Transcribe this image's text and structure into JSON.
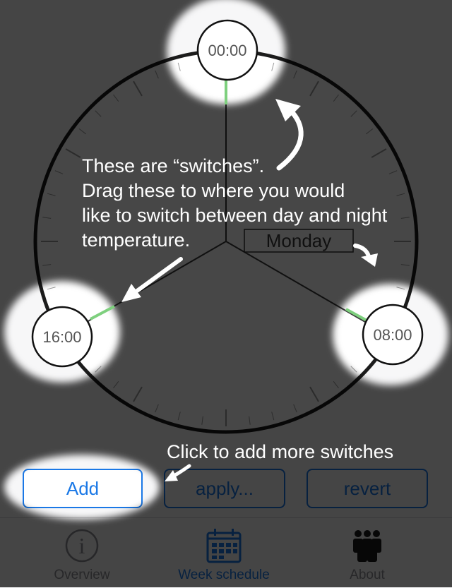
{
  "clock": {
    "day_label": "Monday",
    "switches": [
      {
        "time": "00:00"
      },
      {
        "time": "08:00"
      },
      {
        "time": "16:00"
      }
    ]
  },
  "coachmarks": {
    "switches_hint": [
      "These are “switches”.",
      "Drag these to where you would",
      "like to switch between day and night",
      "temperature."
    ],
    "add_hint": "Click to add more switches"
  },
  "buttons": {
    "add": "Add",
    "apply": "apply...",
    "revert": "revert"
  },
  "tabs": [
    {
      "label": "Overview",
      "icon": "info-icon"
    },
    {
      "label": "Week schedule",
      "icon": "calendar-icon",
      "selected": true
    },
    {
      "label": "About",
      "icon": "people-icon"
    }
  ],
  "colors": {
    "accent": "#1a78e6",
    "switch_line": "#7ed07e",
    "overlay": "rgba(0,0,0,0.72)"
  }
}
